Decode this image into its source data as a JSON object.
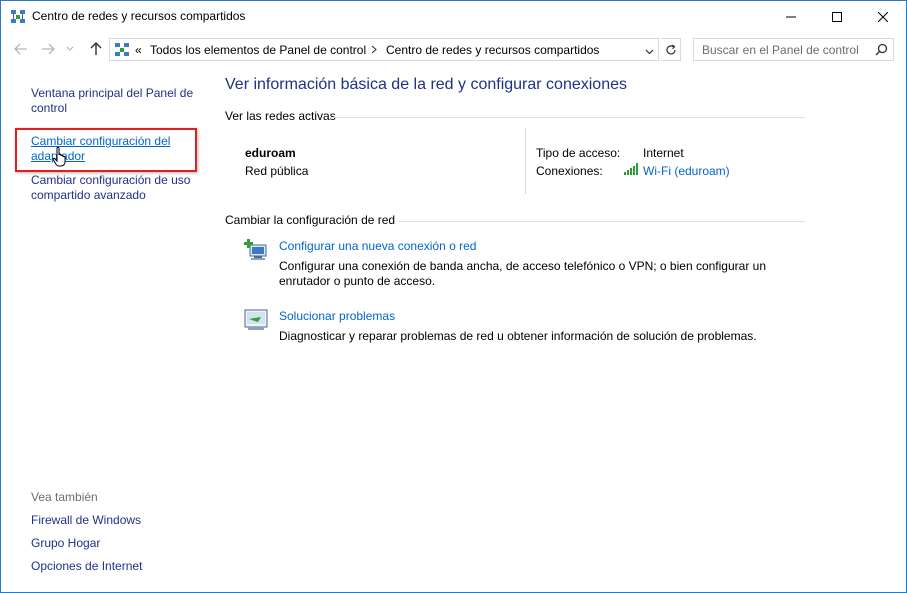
{
  "window": {
    "title": "Centro de redes y recursos compartidos"
  },
  "address": {
    "overflow": "«",
    "crumbs": [
      "Todos los elementos de Panel de control",
      "Centro de redes y recursos compartidos"
    ],
    "search_placeholder": "Buscar en el Panel de control"
  },
  "sidebar": {
    "links": [
      {
        "label": "Ventana principal del Panel de control"
      },
      {
        "label": "Cambiar configuración del adaptador"
      },
      {
        "label": "Cambiar configuración de uso compartido avanzado"
      }
    ],
    "see_also_heading": "Vea también",
    "see_also": [
      {
        "label": "Firewall de Windows"
      },
      {
        "label": "Grupo Hogar"
      },
      {
        "label": "Opciones de Internet"
      }
    ]
  },
  "main": {
    "title": "Ver información básica de la red y configurar conexiones",
    "active_networks_heading": "Ver las redes activas",
    "network": {
      "name": "eduroam",
      "category": "Red pública",
      "access_type_label": "Tipo de acceso:",
      "access_type_value": "Internet",
      "connections_label": "Conexiones:",
      "connection_value": "Wi-Fi (eduroam)"
    },
    "change_heading": "Cambiar la configuración de red",
    "tasks": [
      {
        "icon": "new-connection-icon",
        "link": "Configurar una nueva conexión o red",
        "desc": "Configurar una conexión de banda ancha, de acceso telefónico o VPN; o bien configurar un enrutador o punto de acceso."
      },
      {
        "icon": "troubleshoot-icon",
        "link": "Solucionar problemas",
        "desc": "Diagnosticar y reparar problemas de red u obtener información de solución de problemas."
      }
    ]
  },
  "colors": {
    "link_dark": "#1e3287",
    "link": "#0066cc",
    "highlight_box": "#e02020",
    "separator": "#d5dfe5"
  }
}
